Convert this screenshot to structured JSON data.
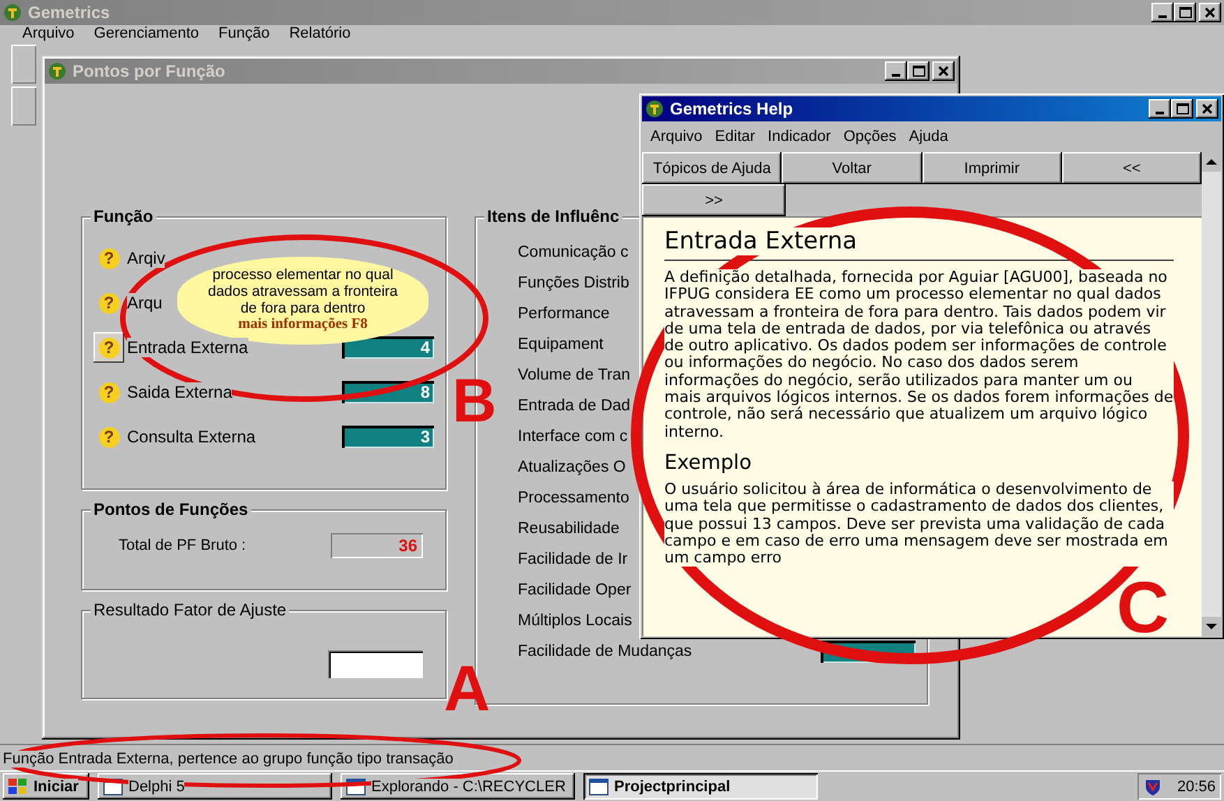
{
  "app_window": {
    "title": "Gemetrics",
    "active": false,
    "menu": [
      "Arquivo",
      "Gerenciamento",
      "Função",
      "Relatório"
    ]
  },
  "function_points_window": {
    "title": "Pontos por Função",
    "active": false,
    "funcao_group": {
      "title": "Função",
      "rows": [
        {
          "mark": "?",
          "label": "Arqiv",
          "focused": false
        },
        {
          "mark": "?",
          "label": "Arqu",
          "focused": false
        },
        {
          "mark": "?",
          "label": "Entrada Externa",
          "focused": true,
          "value": "4"
        },
        {
          "mark": "?",
          "label": "Saida Externa",
          "focused": false,
          "value": "8"
        },
        {
          "mark": "?",
          "label": "Consulta Externa",
          "focused": false,
          "value": "3"
        }
      ]
    },
    "tooltip": {
      "text": "processo elementar  no qual dados atravessam a fronteira de fora para dentro",
      "link": "mais informações F8"
    },
    "pontos_group": {
      "title": "Pontos de Funções",
      "label": "Total de PF Bruto :",
      "value": "36"
    },
    "ajuste_group": {
      "title": "Resultado Fator de Ajuste"
    },
    "influence_group": {
      "title": "Itens de Influênc",
      "items": [
        {
          "label": "Comunicação c",
          "has_field": false
        },
        {
          "label": "Funções Distrib",
          "has_field": false
        },
        {
          "label": "Performance",
          "has_field": false
        },
        {
          "label": "Equipament",
          "has_field": false
        },
        {
          "label": "Volume de Tran",
          "has_field": false
        },
        {
          "label": "Entrada de Dad",
          "has_field": false
        },
        {
          "label": "Interface com c",
          "has_field": false
        },
        {
          "label": "Atualizações O",
          "has_field": false
        },
        {
          "label": "Processamento",
          "has_field": false
        },
        {
          "label": "Reusabilidade",
          "has_field": false
        },
        {
          "label": "Facilidade de Ir",
          "has_field": false
        },
        {
          "label": "Facilidade Oper",
          "has_field": false
        },
        {
          "label": "Múltiplos Locais",
          "has_field": false
        },
        {
          "label": "Facilidade de Mudanças",
          "has_field": true
        }
      ]
    }
  },
  "help_window": {
    "title": "Gemetrics Help",
    "active": true,
    "menu": [
      "Arquivo",
      "Editar",
      "Indicador",
      "Opções",
      "Ajuda"
    ],
    "button_rows": [
      [
        "Tópicos de Ajuda",
        "Voltar",
        "Imprimir",
        "<<"
      ],
      [
        ">>"
      ]
    ],
    "heading": "Entrada Externa",
    "paragraph": "A definição detalhada, fornecida por Aguiar [AGU00], baseada no IFPUG considera EE como um processo elementar no qual dados atravessam a fronteira de fora para dentro. Tais dados podem vir de uma tela de entrada de dados, por via telefônica ou através de outro aplicativo. Os dados podem ser informações de controle ou informações do negócio. No caso dos dados serem informações do negócio, serão utilizados para manter um ou mais arquivos lógicos internos. Se os dados forem informações de controle, não será necessário que atualizem um arquivo lógico interno.",
    "subheading": "Exemplo",
    "example": "O usuário solicitou à área de informática o desenvolvimento de uma tela que permitisse o cadastramento de dados dos clientes, que possui 13 campos. Deve ser prevista uma validação de cada campo e em caso de erro uma mensagem deve ser mostrada em um campo erro"
  },
  "status_bar": "Função Entrada Externa, pertence ao grupo função tipo transação",
  "taskbar": {
    "start": "Iniciar",
    "items": [
      {
        "label": "Delphi 5",
        "selected": false
      },
      {
        "label": "Explorando - C:\\RECYCLER",
        "selected": false
      },
      {
        "label": "Projectprincipal",
        "selected": true
      }
    ],
    "clock": "20:56"
  },
  "annotation_labels": [
    "B",
    "A",
    "C"
  ]
}
